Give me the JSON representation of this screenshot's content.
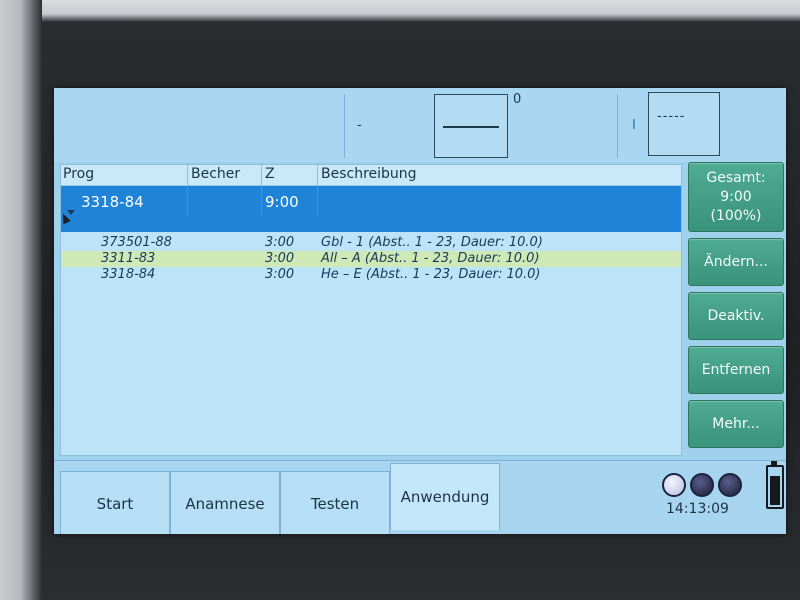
{
  "topbar": {
    "field1_value": "-",
    "box1_counter": "0",
    "field2_value": "I",
    "box2_value": "-----"
  },
  "list": {
    "columns": {
      "prog": "Prog",
      "becher": "Becher",
      "z": "Z",
      "beschreibung": "Beschreibung"
    },
    "selected": {
      "prog": "3318-84",
      "z": "9:00"
    },
    "children": [
      {
        "prog": "373501-88",
        "z": "3:00",
        "beschreibung": "Gbl - 1 (Abst.. 1 - 23, Dauer: 10.0)"
      },
      {
        "prog": "3311-83",
        "z": "3:00",
        "beschreibung": "All – A (Abst.. 1 - 23, Dauer: 10.0)"
      },
      {
        "prog": "3318-84",
        "z": "3:00",
        "beschreibung": "He – E (Abst.. 1 - 23, Dauer: 10.0)"
      }
    ]
  },
  "side": {
    "gesamt_label": "Gesamt:",
    "gesamt_time": "9:00",
    "gesamt_percent": "(100%)",
    "aendern": "Ändern...",
    "deaktiv": "Deaktiv.",
    "entfernen": "Entfernen",
    "mehr": "Mehr..."
  },
  "tabs": [
    "Start",
    "Anamnese",
    "Testen",
    "Anwendung"
  ],
  "active_tab": "Anwendung",
  "status": {
    "clock": "14:13:09",
    "lamps_on": 1,
    "lamps_total": 3,
    "battery_level": 0.85
  },
  "colors": {
    "accent_button": "#4fab92",
    "selection": "#1f83d8",
    "screen_bg": "#9fd0ec"
  }
}
